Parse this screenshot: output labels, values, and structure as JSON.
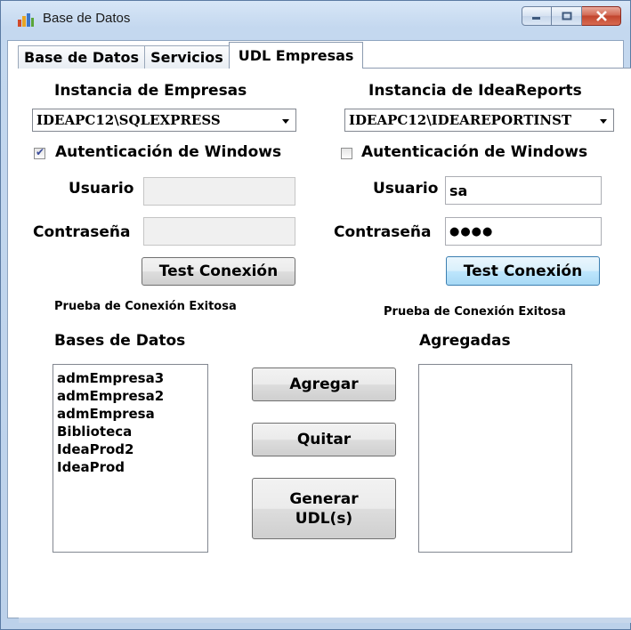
{
  "window": {
    "title": "Base de Datos"
  },
  "tabs": [
    {
      "label": "Base de Datos"
    },
    {
      "label": "Servicios"
    },
    {
      "label": "UDL Empresas"
    }
  ],
  "left": {
    "heading": "Instancia de Empresas",
    "instance_value": "IDEAPC12\\SQLEXPRESS",
    "windows_auth_label": "Autenticación de Windows",
    "windows_auth_checked": true,
    "user_label": "Usuario",
    "user_value": "",
    "password_label": "Contraseña",
    "password_value": "",
    "test_button": "Test Conexión",
    "status": "Prueba de Conexión Exitosa"
  },
  "right": {
    "heading": "Instancia de IdeaReports",
    "instance_value": "IDEAPC12\\IDEAREPORTINST",
    "windows_auth_label": "Autenticación de Windows",
    "windows_auth_checked": false,
    "user_label": "Usuario",
    "user_value": "sa",
    "password_label": "Contraseña",
    "password_value": "●●●●",
    "test_button": "Test Conexión",
    "status": "Prueba de Conexión Exitosa"
  },
  "databases": {
    "label": "Bases de  Datos",
    "items": [
      "admEmpresa3",
      "admEmpresa2",
      "admEmpresa",
      "Biblioteca",
      "IdeaProd2",
      "IdeaProd"
    ]
  },
  "added": {
    "label": "Agregadas",
    "items": []
  },
  "actions": {
    "add": "Agregar",
    "remove": "Quitar",
    "generate_line1": "Generar",
    "generate_line2": "UDL(s)"
  }
}
